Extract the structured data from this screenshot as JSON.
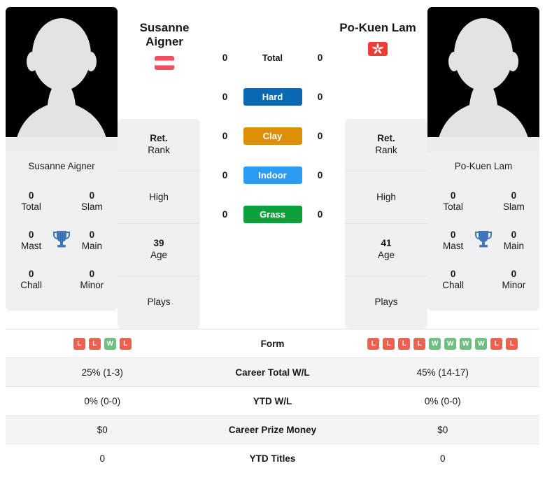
{
  "players": {
    "left": {
      "name": "Susanne Aigner",
      "name_line1": "Susanne",
      "name_line2": "Aigner",
      "country": "Austria",
      "flag_icon": "flag-austria",
      "photo_alt": "player-photo-placeholder",
      "titles": {
        "total": "0",
        "total_label": "Total",
        "slam": "0",
        "slam_label": "Slam",
        "mast": "0",
        "mast_label": "Mast",
        "main": "0",
        "main_label": "Main",
        "chall": "0",
        "chall_label": "Chall",
        "minor": "0",
        "minor_label": "Minor"
      },
      "info": [
        {
          "value": "Ret.",
          "label": "Rank"
        },
        {
          "value": "",
          "label": "High"
        },
        {
          "value": "39",
          "label": "Age"
        },
        {
          "value": "",
          "label": "Plays"
        }
      ]
    },
    "right": {
      "name": "Po-Kuen Lam",
      "name_line1": "Po-Kuen Lam",
      "name_line2": "",
      "country": "Hong Kong",
      "flag_icon": "flag-hong-kong",
      "photo_alt": "player-photo-placeholder",
      "titles": {
        "total": "0",
        "total_label": "Total",
        "slam": "0",
        "slam_label": "Slam",
        "mast": "0",
        "mast_label": "Mast",
        "main": "0",
        "main_label": "Main",
        "chall": "0",
        "chall_label": "Chall",
        "minor": "0",
        "minor_label": "Minor"
      },
      "info": [
        {
          "value": "Ret.",
          "label": "Rank"
        },
        {
          "value": "",
          "label": "High"
        },
        {
          "value": "41",
          "label": "Age"
        },
        {
          "value": "",
          "label": "Plays"
        }
      ]
    }
  },
  "surfaces": [
    {
      "label": "Total",
      "left": "0",
      "right": "0",
      "color": "transparent",
      "plain": true
    },
    {
      "label": "Hard",
      "left": "0",
      "right": "0",
      "color": "#0B69B4",
      "plain": false
    },
    {
      "label": "Clay",
      "left": "0",
      "right": "0",
      "color": "#DD9006",
      "plain": false
    },
    {
      "label": "Indoor",
      "left": "0",
      "right": "0",
      "color": "#2B9BF4",
      "plain": false
    },
    {
      "label": "Grass",
      "left": "0",
      "right": "0",
      "color": "#0FA03C",
      "plain": false
    }
  ],
  "stats_table": [
    {
      "label": "Form",
      "type": "form",
      "left_form": [
        "L",
        "L",
        "W",
        "L"
      ],
      "right_form": [
        "L",
        "L",
        "L",
        "L",
        "W",
        "W",
        "W",
        "W",
        "L",
        "L"
      ]
    },
    {
      "label": "Career Total W/L",
      "type": "text",
      "left": "25% (1-3)",
      "right": "45% (14-17)"
    },
    {
      "label": "YTD W/L",
      "type": "text",
      "left": "0% (0-0)",
      "right": "0% (0-0)"
    },
    {
      "label": "Career Prize Money",
      "type": "text",
      "left": "$0",
      "right": "$0"
    },
    {
      "label": "YTD Titles",
      "type": "text",
      "left": "0",
      "right": "0"
    }
  ],
  "colors": {
    "win_badge": "#6FC080",
    "loss_badge": "#F06050",
    "trophy": "#3F76B8",
    "card_bg": "#f0f0f0",
    "flag_austria_red": "#F04E5E",
    "flag_hk_red": "#EE3B33"
  },
  "icons": {
    "trophy": "trophy-icon"
  }
}
